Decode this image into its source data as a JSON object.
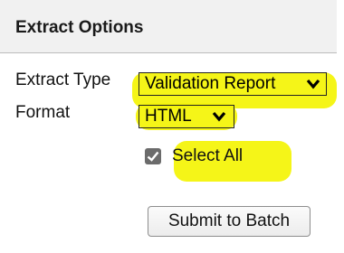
{
  "panel": {
    "title": "Extract Options"
  },
  "fields": {
    "extract_type_label": "Extract Type",
    "extract_type_value": "Validation Report",
    "format_label": "Format",
    "format_value": "HTML",
    "select_all_label": "Select All",
    "select_all_checked": true
  },
  "actions": {
    "submit_label": "Submit to Batch"
  },
  "icons": {
    "dropdown": "chevron-down-icon",
    "checkbox": "check-icon"
  },
  "colors": {
    "highlight": "#f4f40c",
    "header_bg": "#f1f1f1",
    "checkbox_bg": "#6b6b6b"
  }
}
